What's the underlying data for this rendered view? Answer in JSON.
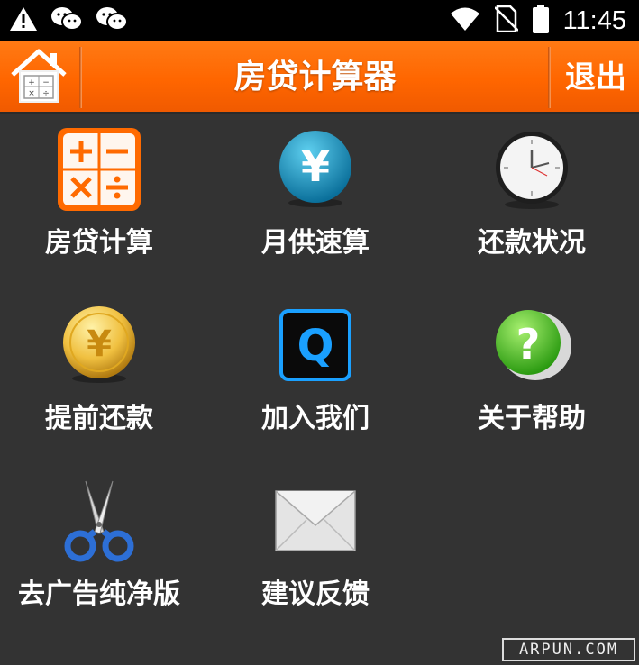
{
  "status_bar": {
    "time": "11:45",
    "icons": [
      "warning-icon",
      "wechat-icon",
      "wechat-icon",
      "wifi-icon",
      "no-sim-icon",
      "battery-icon"
    ]
  },
  "header": {
    "title": "房贷计算器",
    "exit_label": "退出",
    "home_icon": "home-calculator-icon"
  },
  "menu": [
    {
      "label": "房贷计算",
      "icon": "calculator-icon"
    },
    {
      "label": "月供速算",
      "icon": "yen-coin-icon"
    },
    {
      "label": "还款状况",
      "icon": "clock-icon"
    },
    {
      "label": "提前还款",
      "icon": "gold-yen-coin-icon"
    },
    {
      "label": "加入我们",
      "icon": "q-icon"
    },
    {
      "label": "关于帮助",
      "icon": "help-icon"
    },
    {
      "label": "去广告纯净版",
      "icon": "scissors-icon"
    },
    {
      "label": "建议反馈",
      "icon": "envelope-icon"
    }
  ],
  "watermark": "ARPUN.COM",
  "colors": {
    "accent": "#ff6600",
    "background": "#333333"
  }
}
